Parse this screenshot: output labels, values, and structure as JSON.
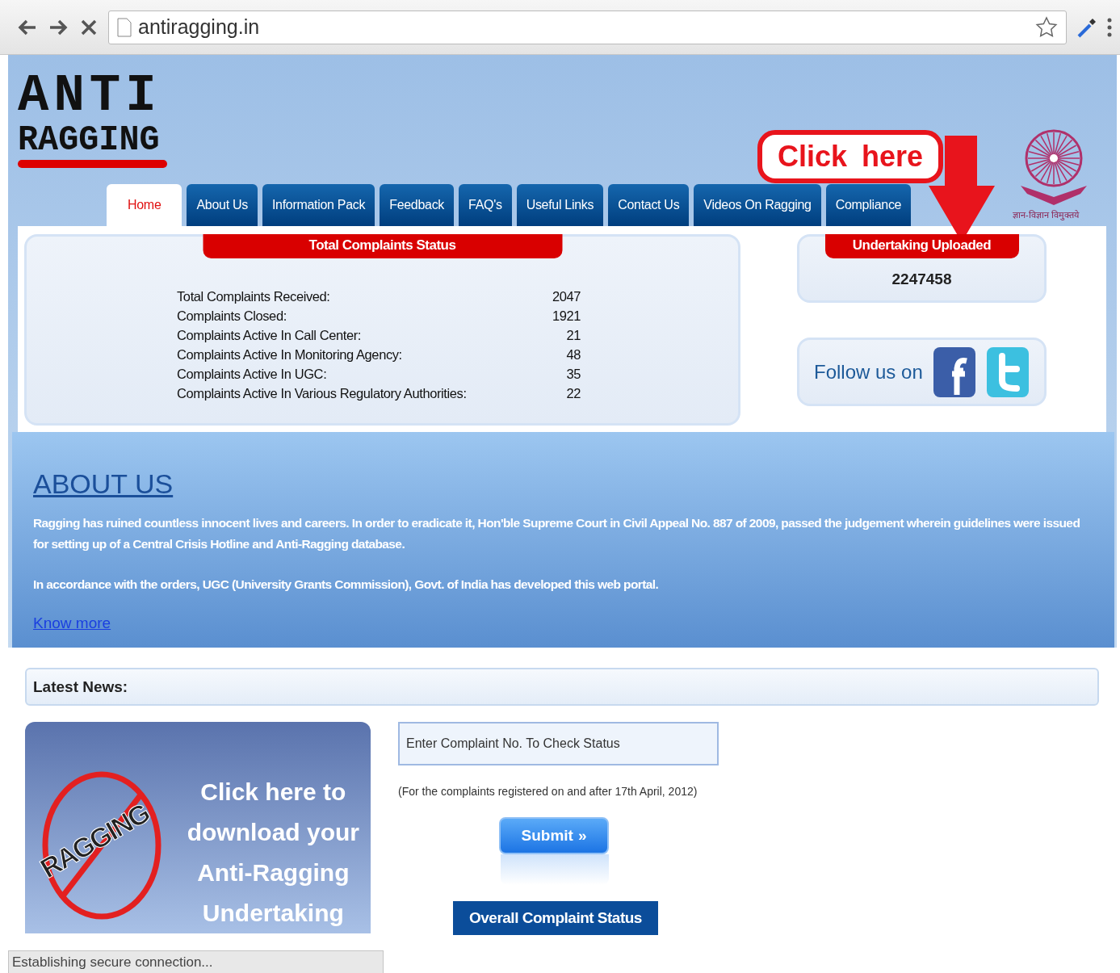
{
  "browser": {
    "url": "antiragging.in"
  },
  "header": {
    "logo_line_1": "ANTI",
    "logo_line_2": "RAGGING",
    "annotation": "Click here",
    "emblem_motto": "ज्ञान-विज्ञान विमुक्तये"
  },
  "tabs": [
    {
      "label": "Home",
      "selected": true
    },
    {
      "label": "About Us",
      "selected": false
    },
    {
      "label": "Information Pack",
      "selected": false
    },
    {
      "label": "Feedback",
      "selected": false
    },
    {
      "label": "FAQ's",
      "selected": false
    },
    {
      "label": "Useful Links",
      "selected": false
    },
    {
      "label": "Contact Us",
      "selected": false
    },
    {
      "label": "Videos On Ragging",
      "selected": false
    },
    {
      "label": "Compliance",
      "selected": false
    }
  ],
  "complaints_status": {
    "title": "Total Complaints Status",
    "rows": [
      {
        "label": "Total Complaints Received:",
        "value": "2047"
      },
      {
        "label": "Complaints Closed:",
        "value": "1921"
      },
      {
        "label": "Complaints Active In Call Center:",
        "value": "21"
      },
      {
        "label": "Complaints Active In Monitoring Agency:",
        "value": "48"
      },
      {
        "label": "Complaints Active In UGC:",
        "value": "35"
      },
      {
        "label": "Complaints Active In Various Regulatory Authorities:",
        "value": "22"
      }
    ]
  },
  "undertaking": {
    "title": "Undertaking Uploaded",
    "count": "2247458"
  },
  "follow": {
    "label": "Follow us on"
  },
  "about": {
    "heading": "ABOUT US",
    "paragraphs": [
      "Ragging has ruined countless innocent lives and careers. In order to eradicate it, Hon'ble Supreme Court in Civil Appeal No. 887 of 2009, passed the judgement wherein guidelines were issued for setting up of a Central Crisis Hotline and Anti-Ragging database.",
      "In accordance with the orders, UGC (University Grants Commission), Govt. of India has developed this web portal."
    ],
    "link": "Know more"
  },
  "news": {
    "label": "Latest News:"
  },
  "banner": {
    "stamp": "RAGGING",
    "lines": [
      "Click here to",
      "download your",
      "Anti-Ragging",
      "Undertaking"
    ]
  },
  "complaint_check": {
    "placeholder": "Enter Complaint No. To Check Status",
    "note": "(For the complaints registered on and after 17th April, 2012)",
    "submit": "Submit",
    "submit_icon": "»",
    "overall": "Overall Complaint Status"
  },
  "status_bar": "Establishing secure connection..."
}
